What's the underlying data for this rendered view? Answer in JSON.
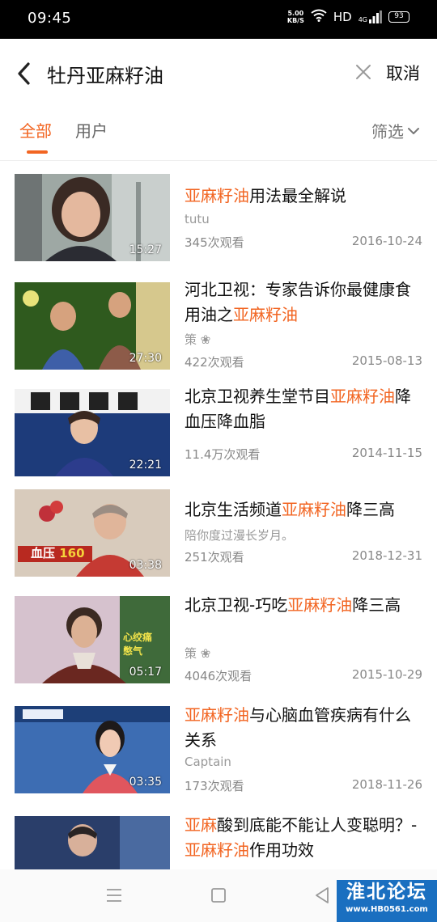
{
  "status_bar": {
    "time": "09:45",
    "net_speed_value": "5.00",
    "net_speed_unit": "KB/S",
    "hd": "HD",
    "network": "4G",
    "battery": "93"
  },
  "search": {
    "query": "牡丹亚麻籽油",
    "cancel_label": "取消"
  },
  "tabs": {
    "all_label": "全部",
    "users_label": "用户",
    "filter_label": "筛选"
  },
  "accent_color": "#f26522",
  "results": [
    {
      "title_parts": [
        {
          "text": "亚麻籽油",
          "hl": true
        },
        {
          "text": "用法最全解说",
          "hl": false
        }
      ],
      "author": "tutu",
      "views": "345次观看",
      "date": "2016-10-24",
      "duration": "15:27"
    },
    {
      "title_parts": [
        {
          "text": "河北卫视：专家告诉你最健康食用油之",
          "hl": false
        },
        {
          "text": "亚麻籽油",
          "hl": true
        }
      ],
      "author": "策 ❀",
      "views": "422次观看",
      "date": "2015-08-13",
      "duration": "27:30"
    },
    {
      "title_parts": [
        {
          "text": "北京卫视养生堂节目",
          "hl": false
        },
        {
          "text": "亚麻籽油",
          "hl": true
        },
        {
          "text": "降血压降血脂",
          "hl": false
        }
      ],
      "author": "",
      "views": "11.4万次观看",
      "date": "2014-11-15",
      "duration": "22:21"
    },
    {
      "title_parts": [
        {
          "text": "北京生活频道",
          "hl": false
        },
        {
          "text": "亚麻籽油",
          "hl": true
        },
        {
          "text": "降三高",
          "hl": false
        }
      ],
      "author": "陪你度过漫长岁月。",
      "views": "251次观看",
      "date": "2018-12-31",
      "duration": "03:38"
    },
    {
      "title_parts": [
        {
          "text": "北京卫视-巧吃",
          "hl": false
        },
        {
          "text": "亚麻籽油",
          "hl": true
        },
        {
          "text": "降三高",
          "hl": false
        }
      ],
      "author": "策 ❀",
      "views": "4046次观看",
      "date": "2015-10-29",
      "duration": "05:17"
    },
    {
      "title_parts": [
        {
          "text": "亚麻籽油",
          "hl": true
        },
        {
          "text": "与心脑血管疾病有什么关系",
          "hl": false
        }
      ],
      "author": "Captain",
      "views": "173次观看",
      "date": "2018-11-26",
      "duration": "03:35"
    },
    {
      "title_parts": [
        {
          "text": "亚麻",
          "hl": true
        },
        {
          "text": "酸到底能不能让人变聪明？-",
          "hl": false
        },
        {
          "text": "亚麻籽油",
          "hl": true
        },
        {
          "text": "作用功效",
          "hl": false
        }
      ],
      "author": "",
      "views": "",
      "date": "",
      "duration": ""
    }
  ],
  "watermark": {
    "title": "淮北论坛",
    "url": "www.HB0561.com"
  }
}
